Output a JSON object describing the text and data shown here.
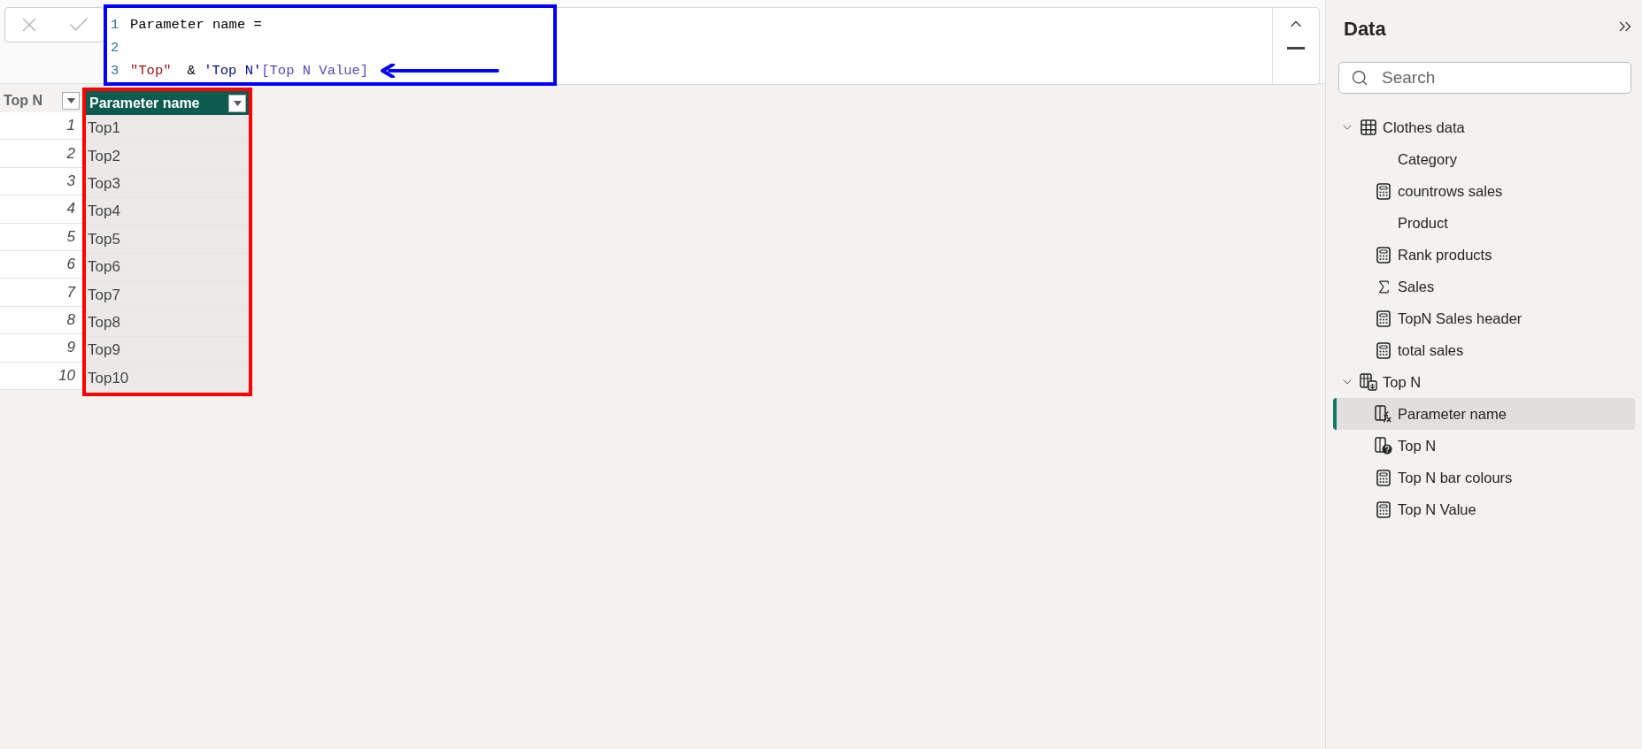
{
  "formula": {
    "lines": [
      {
        "number": "1",
        "tokens": [
          {
            "kind": "plain",
            "text": "Parameter name ="
          }
        ]
      },
      {
        "number": "2"
      },
      {
        "number": "3",
        "tokens": [
          {
            "kind": "string",
            "text": "\"Top\""
          },
          {
            "kind": "plain",
            "text": "& "
          },
          {
            "kind": "table",
            "text": "'Top N'"
          },
          {
            "kind": "column",
            "text": "[Top N Value]"
          }
        ]
      }
    ]
  },
  "table": {
    "columns": [
      {
        "label": "Top N",
        "selected": false
      },
      {
        "label": "Parameter name",
        "selected": true
      }
    ],
    "rows": [
      [
        "1",
        "Top1"
      ],
      [
        "2",
        "Top2"
      ],
      [
        "3",
        "Top3"
      ],
      [
        "4",
        "Top4"
      ],
      [
        "5",
        "Top5"
      ],
      [
        "6",
        "Top6"
      ],
      [
        "7",
        "Top7"
      ],
      [
        "8",
        "Top8"
      ],
      [
        "9",
        "Top9"
      ],
      [
        "10",
        "Top10"
      ]
    ]
  },
  "data_panel": {
    "title": "Data",
    "search": {
      "placeholder": "Search"
    },
    "tree": [
      {
        "label": "Clothes data",
        "kind": "table",
        "expanded": true,
        "selected": false,
        "children": [
          {
            "label": "Category",
            "kind": "column",
            "selected": false
          },
          {
            "label": "countrows sales",
            "kind": "measure",
            "selected": false
          },
          {
            "label": "Product",
            "kind": "column",
            "selected": false
          },
          {
            "label": "Rank products",
            "kind": "measure",
            "selected": false
          },
          {
            "label": "Sales",
            "kind": "sum",
            "selected": false
          },
          {
            "label": "TopN Sales header",
            "kind": "measure",
            "selected": false
          },
          {
            "label": "total sales",
            "kind": "measure",
            "selected": false
          }
        ]
      },
      {
        "label": "Top N",
        "kind": "parameter-table",
        "expanded": true,
        "selected": false,
        "children": [
          {
            "label": "Parameter name",
            "kind": "calculated-column",
            "selected": true
          },
          {
            "label": "Top N",
            "kind": "parameter",
            "selected": false
          },
          {
            "label": "Top N bar colours",
            "kind": "measure",
            "selected": false
          },
          {
            "label": "Top N Value",
            "kind": "measure",
            "selected": false
          }
        ]
      }
    ]
  }
}
